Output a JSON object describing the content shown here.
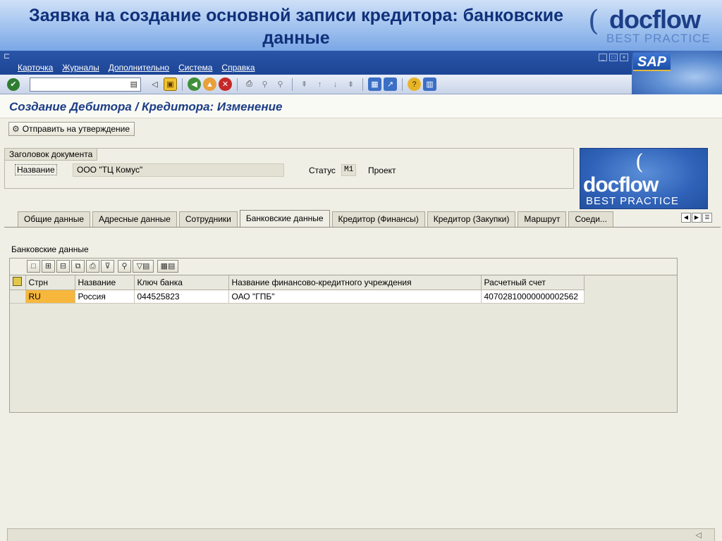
{
  "slide": {
    "title": "Заявка на создание основной записи кредитора: банковские данные",
    "brand": {
      "word": "docflow",
      "tag": "BEST PRACTICE"
    }
  },
  "menu": {
    "items": [
      "Карточка",
      "Журналы",
      "Дополнительно",
      "Система",
      "Справка"
    ]
  },
  "window_controls": [
    "_",
    "□",
    "×"
  ],
  "sap_logo": "SAP",
  "toolbar": {
    "command_value": ""
  },
  "screen": {
    "title": "Создание Дебитора / Кредитора: Изменение"
  },
  "app_toolbar": {
    "send_label": "Отправить на утверждение"
  },
  "header": {
    "legend": "Заголовок документа",
    "name_label": "Название",
    "name_value": "ООО \"ТЦ Комус\"",
    "status_label": "Статус",
    "status_code": "M1",
    "status_text": "Проект"
  },
  "tabs": [
    {
      "label": "Общие данные"
    },
    {
      "label": "Адресные данные"
    },
    {
      "label": "Сотрудники"
    },
    {
      "label": "Банковские данные",
      "active": true
    },
    {
      "label": "Кредитор (Финансы)"
    },
    {
      "label": "Кредитор (Закупки)"
    },
    {
      "label": "Маршрут"
    },
    {
      "label": "Соеди..."
    }
  ],
  "panel": {
    "section_label": "Банковские данные"
  },
  "grid": {
    "columns": [
      "Стрн",
      "Название",
      "Ключ банка",
      "Название финансово-кредитного учреждения",
      "Расчетный счет"
    ],
    "rows": [
      [
        "RU",
        "Россия",
        "044525823",
        "ОАО \"ГПБ\"",
        "40702810000000002562"
      ]
    ]
  }
}
